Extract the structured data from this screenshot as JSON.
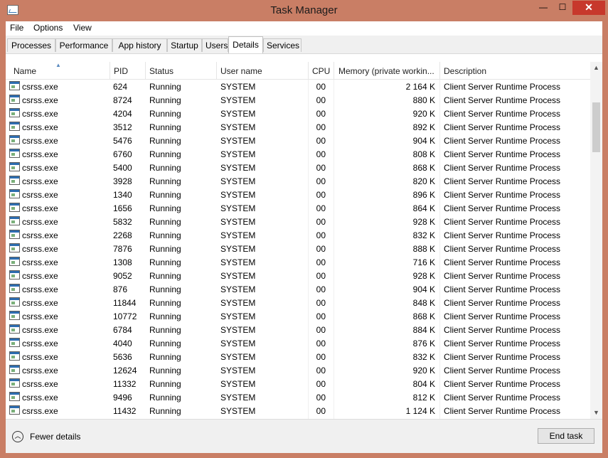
{
  "window": {
    "title": "Task Manager",
    "minimize": "—",
    "maximize": "☐",
    "close": "✕"
  },
  "menu": [
    "File",
    "Options",
    "View"
  ],
  "tabs": [
    "Processes",
    "Performance",
    "App history",
    "Startup",
    "Users",
    "Details",
    "Services"
  ],
  "active_tab": "Details",
  "columns": [
    "Name",
    "PID",
    "Status",
    "User name",
    "CPU",
    "Memory (private workin...",
    "Description"
  ],
  "rows": [
    {
      "name": "csrss.exe",
      "pid": "624",
      "status": "Running",
      "user": "SYSTEM",
      "cpu": "00",
      "mem": "2 164 K",
      "desc": "Client Server Runtime Process"
    },
    {
      "name": "csrss.exe",
      "pid": "8724",
      "status": "Running",
      "user": "SYSTEM",
      "cpu": "00",
      "mem": "880 K",
      "desc": "Client Server Runtime Process"
    },
    {
      "name": "csrss.exe",
      "pid": "4204",
      "status": "Running",
      "user": "SYSTEM",
      "cpu": "00",
      "mem": "920 K",
      "desc": "Client Server Runtime Process"
    },
    {
      "name": "csrss.exe",
      "pid": "3512",
      "status": "Running",
      "user": "SYSTEM",
      "cpu": "00",
      "mem": "892 K",
      "desc": "Client Server Runtime Process"
    },
    {
      "name": "csrss.exe",
      "pid": "5476",
      "status": "Running",
      "user": "SYSTEM",
      "cpu": "00",
      "mem": "904 K",
      "desc": "Client Server Runtime Process"
    },
    {
      "name": "csrss.exe",
      "pid": "6760",
      "status": "Running",
      "user": "SYSTEM",
      "cpu": "00",
      "mem": "808 K",
      "desc": "Client Server Runtime Process"
    },
    {
      "name": "csrss.exe",
      "pid": "5400",
      "status": "Running",
      "user": "SYSTEM",
      "cpu": "00",
      "mem": "868 K",
      "desc": "Client Server Runtime Process"
    },
    {
      "name": "csrss.exe",
      "pid": "3928",
      "status": "Running",
      "user": "SYSTEM",
      "cpu": "00",
      "mem": "820 K",
      "desc": "Client Server Runtime Process"
    },
    {
      "name": "csrss.exe",
      "pid": "1340",
      "status": "Running",
      "user": "SYSTEM",
      "cpu": "00",
      "mem": "896 K",
      "desc": "Client Server Runtime Process"
    },
    {
      "name": "csrss.exe",
      "pid": "1656",
      "status": "Running",
      "user": "SYSTEM",
      "cpu": "00",
      "mem": "864 K",
      "desc": "Client Server Runtime Process"
    },
    {
      "name": "csrss.exe",
      "pid": "5832",
      "status": "Running",
      "user": "SYSTEM",
      "cpu": "00",
      "mem": "928 K",
      "desc": "Client Server Runtime Process"
    },
    {
      "name": "csrss.exe",
      "pid": "2268",
      "status": "Running",
      "user": "SYSTEM",
      "cpu": "00",
      "mem": "832 K",
      "desc": "Client Server Runtime Process"
    },
    {
      "name": "csrss.exe",
      "pid": "7876",
      "status": "Running",
      "user": "SYSTEM",
      "cpu": "00",
      "mem": "888 K",
      "desc": "Client Server Runtime Process"
    },
    {
      "name": "csrss.exe",
      "pid": "1308",
      "status": "Running",
      "user": "SYSTEM",
      "cpu": "00",
      "mem": "716 K",
      "desc": "Client Server Runtime Process"
    },
    {
      "name": "csrss.exe",
      "pid": "9052",
      "status": "Running",
      "user": "SYSTEM",
      "cpu": "00",
      "mem": "928 K",
      "desc": "Client Server Runtime Process"
    },
    {
      "name": "csrss.exe",
      "pid": "876",
      "status": "Running",
      "user": "SYSTEM",
      "cpu": "00",
      "mem": "904 K",
      "desc": "Client Server Runtime Process"
    },
    {
      "name": "csrss.exe",
      "pid": "11844",
      "status": "Running",
      "user": "SYSTEM",
      "cpu": "00",
      "mem": "848 K",
      "desc": "Client Server Runtime Process"
    },
    {
      "name": "csrss.exe",
      "pid": "10772",
      "status": "Running",
      "user": "SYSTEM",
      "cpu": "00",
      "mem": "868 K",
      "desc": "Client Server Runtime Process"
    },
    {
      "name": "csrss.exe",
      "pid": "6784",
      "status": "Running",
      "user": "SYSTEM",
      "cpu": "00",
      "mem": "884 K",
      "desc": "Client Server Runtime Process"
    },
    {
      "name": "csrss.exe",
      "pid": "4040",
      "status": "Running",
      "user": "SYSTEM",
      "cpu": "00",
      "mem": "876 K",
      "desc": "Client Server Runtime Process"
    },
    {
      "name": "csrss.exe",
      "pid": "5636",
      "status": "Running",
      "user": "SYSTEM",
      "cpu": "00",
      "mem": "832 K",
      "desc": "Client Server Runtime Process"
    },
    {
      "name": "csrss.exe",
      "pid": "12624",
      "status": "Running",
      "user": "SYSTEM",
      "cpu": "00",
      "mem": "920 K",
      "desc": "Client Server Runtime Process"
    },
    {
      "name": "csrss.exe",
      "pid": "11332",
      "status": "Running",
      "user": "SYSTEM",
      "cpu": "00",
      "mem": "804 K",
      "desc": "Client Server Runtime Process"
    },
    {
      "name": "csrss.exe",
      "pid": "9496",
      "status": "Running",
      "user": "SYSTEM",
      "cpu": "00",
      "mem": "812 K",
      "desc": "Client Server Runtime Process"
    },
    {
      "name": "csrss.exe",
      "pid": "11432",
      "status": "Running",
      "user": "SYSTEM",
      "cpu": "00",
      "mem": "1 124 K",
      "desc": "Client Server Runtime Process"
    }
  ],
  "footer": {
    "fewer_details": "Fewer details",
    "end_task": "End task"
  },
  "colors": {
    "frame": "#c97e65",
    "close": "#c7382c",
    "window_bg": "#ffffff",
    "tab_bg": "#f0f0f0"
  },
  "icons": {
    "app": "task-manager-icon",
    "process": "process-icon",
    "collapse": "chevron-up-icon"
  }
}
